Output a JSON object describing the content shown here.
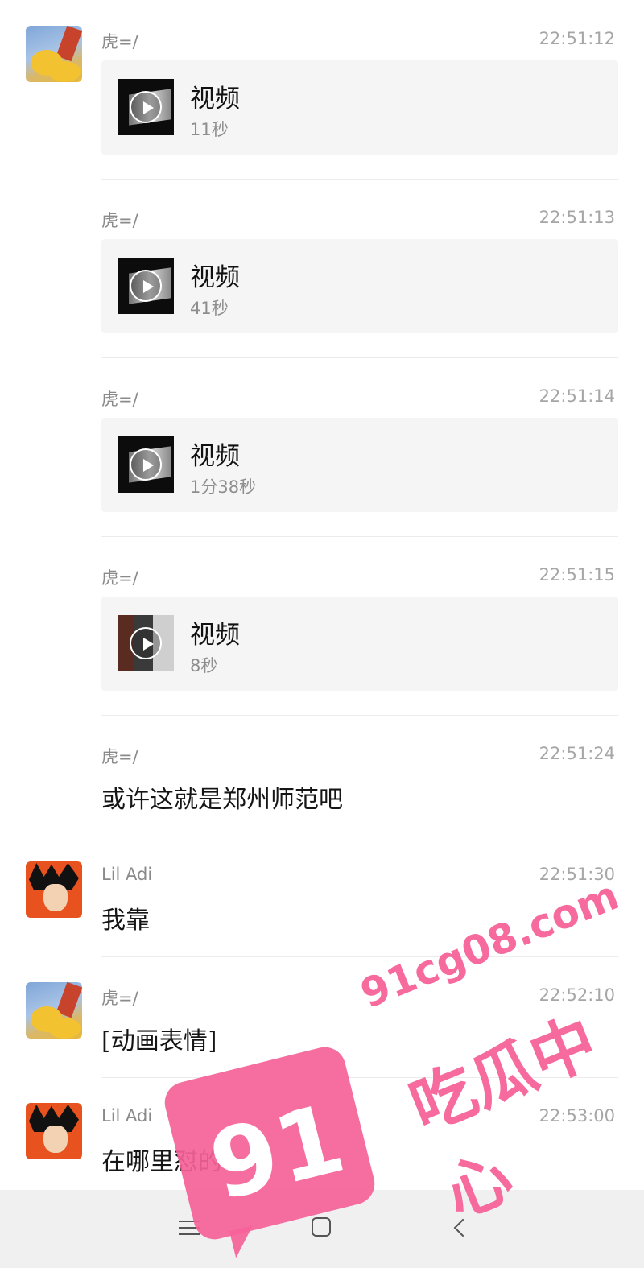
{
  "messages": [
    {
      "sender": "虎=/",
      "time": "22:51:12",
      "type": "video",
      "card_title": "视频",
      "duration": "11秒",
      "avatar": "pooh-avatar"
    },
    {
      "sender": "虎=/",
      "time": "22:51:13",
      "type": "video",
      "card_title": "视频",
      "duration": "41秒"
    },
    {
      "sender": "虎=/",
      "time": "22:51:14",
      "type": "video",
      "card_title": "视频",
      "duration": "1分38秒"
    },
    {
      "sender": "虎=/",
      "time": "22:51:15",
      "type": "video",
      "card_title": "视频",
      "duration": "8秒"
    },
    {
      "sender": "虎=/",
      "time": "22:51:24",
      "type": "text",
      "text": "或许这就是郑州师范吧"
    },
    {
      "sender": "Lil Adi",
      "time": "22:51:30",
      "type": "text",
      "text": "我靠",
      "avatar": "goku-avatar"
    },
    {
      "sender": "虎=/",
      "time": "22:52:10",
      "type": "text",
      "text": "[动画表情]",
      "avatar": "pooh-avatar"
    },
    {
      "sender": "Lil Adi",
      "time": "22:53:00",
      "type": "text",
      "text": "在哪里怼的",
      "avatar": "goku-avatar"
    }
  ],
  "navbar": {
    "icons": [
      "menu-icon",
      "home-icon",
      "back-icon"
    ]
  },
  "watermark": {
    "number": "91",
    "url": "91cg08.com",
    "name": "吃瓜中心"
  },
  "colors": {
    "card_bg": "#f5f5f5",
    "navbar_bg": "#f0f0f0",
    "watermark": "#f56298"
  }
}
